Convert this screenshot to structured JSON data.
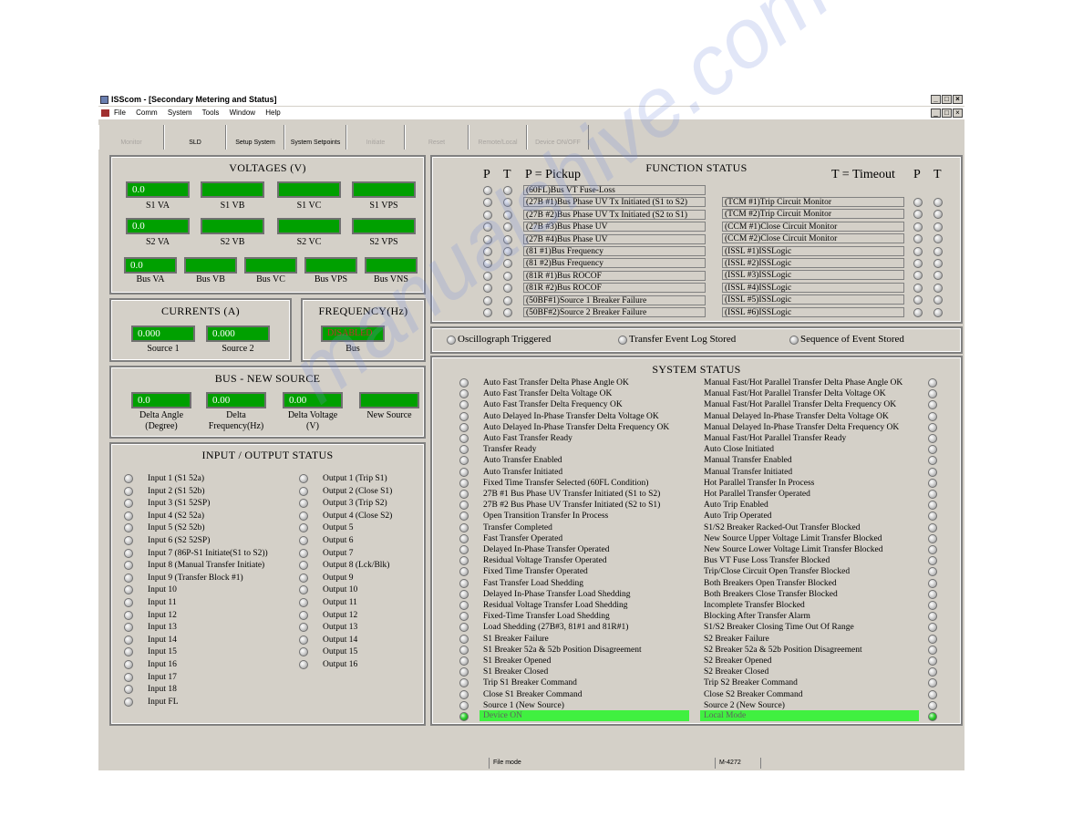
{
  "window": {
    "title": "ISScom - [Secondary Metering and Status]",
    "min": "_",
    "max": "□",
    "close": "×"
  },
  "menu": [
    "File",
    "Comm",
    "System",
    "Tools",
    "Window",
    "Help"
  ],
  "toolbar": [
    "Monitor",
    "SLD",
    "Setup System",
    "System Setpoints",
    "Initiate",
    "Reset",
    "Remote/Local",
    "Device ON/OFF"
  ],
  "voltages": {
    "title": "VOLTAGES (V)",
    "row1": [
      {
        "label": "S1 VA",
        "value": "0.0"
      },
      {
        "label": "S1 VB",
        "value": ""
      },
      {
        "label": "S1 VC",
        "value": ""
      },
      {
        "label": "S1 VPS",
        "value": ""
      }
    ],
    "row2": [
      {
        "label": "S2 VA",
        "value": "0.0"
      },
      {
        "label": "S2 VB",
        "value": ""
      },
      {
        "label": "S2 VC",
        "value": ""
      },
      {
        "label": "S2 VPS",
        "value": ""
      }
    ],
    "row3": [
      {
        "label": "Bus VA",
        "value": "0.0"
      },
      {
        "label": "Bus VB",
        "value": ""
      },
      {
        "label": "Bus VC",
        "value": ""
      },
      {
        "label": "Bus VPS",
        "value": ""
      },
      {
        "label": "Bus VNS",
        "value": ""
      }
    ]
  },
  "currents": {
    "title": "CURRENTS (A)",
    "items": [
      {
        "label": "Source 1",
        "value": "0.000"
      },
      {
        "label": "Source 2",
        "value": "0.000"
      }
    ]
  },
  "frequency": {
    "title": "FREQUENCY(Hz)",
    "value": "DISABLED",
    "label": "Bus"
  },
  "bus_new_source": {
    "title": "BUS - NEW SOURCE",
    "items": [
      {
        "value": "0.0",
        "label1": "Delta  Angle",
        "label2": "(Degree)"
      },
      {
        "value": "0.00",
        "label1": "Delta",
        "label2": "Frequency(Hz)"
      },
      {
        "value": "0.00",
        "label1": "Delta Voltage",
        "label2": "(V)"
      },
      {
        "value": "",
        "label1": "New Source",
        "label2": ""
      }
    ]
  },
  "io_status": {
    "title": "INPUT / OUTPUT STATUS",
    "inputs": [
      "Input 1 (S1 52a)",
      "Input 2 (S1 52b)",
      "Input 3 (S1 52SP)",
      "Input 4 (S2 52a)",
      "Input 5 (S2 52b)",
      "Input 6 (S2 52SP)",
      "Input 7 (86P-S1 Initiate(S1 to S2))",
      "Input 8 (Manual Transfer Initiate)",
      "Input 9 (Transfer Block #1)",
      "Input 10",
      "Input 11",
      "Input 12",
      "Input 13",
      "Input 14",
      "Input 15",
      "Input 16",
      "Input 17",
      "Input 18",
      "Input FL"
    ],
    "outputs": [
      "Output 1 (Trip S1)",
      "Output 2 (Close S1)",
      "Output 3 (Trip S2)",
      "Output 4 (Close S2)",
      "Output 5",
      "Output 6",
      "Output 7",
      "Output 8 (Lck/Blk)",
      "Output 9",
      "Output 10",
      "Output 11",
      "Output 12",
      "Output 13",
      "Output 14",
      "Output 15",
      "Output 16"
    ]
  },
  "function_status": {
    "title": "FUNCTION  STATUS",
    "p": "P",
    "t": "T",
    "pickup": "P = Pickup",
    "timeout": "T = Timeout",
    "left": [
      "(60FL)Bus VT Fuse-Loss",
      "(27B #1)Bus Phase UV Tx Initiated (S1 to S2)",
      "(27B #2)Bus Phase UV Tx Initiated (S2 to S1)",
      "(27B #3)Bus Phase UV",
      "(27B #4)Bus Phase UV",
      "(81 #1)Bus Frequency",
      "(81 #2)Bus Frequency",
      "(81R #1)Bus ROCOF",
      "(81R #2)Bus ROCOF",
      "(50BF#1)Source 1 Breaker Failure",
      "(50BF#2)Source 2 Breaker Failure"
    ],
    "right": [
      "(TCM #1)Trip Circuit Monitor",
      "(TCM #2)Trip Circuit Monitor",
      "(CCM #1)Close Circuit Monitor",
      "(CCM #2)Close Circuit Monitor",
      "(ISSL #1)ISSLogic",
      "(ISSL #2)ISSLogic",
      "(ISSL #3)ISSLogic",
      "(ISSL #4)ISSLogic",
      "(ISSL #5)ISSLogic",
      "(ISSL #6)ISSLogic"
    ]
  },
  "events": [
    "Oscillograph Triggered",
    "Transfer Event Log Stored",
    "Sequence of Event Stored"
  ],
  "system_status": {
    "title": "SYSTEM  STATUS",
    "left": [
      "Auto Fast Transfer Delta Phase Angle OK",
      "Auto Fast Transfer Delta Voltage OK",
      "Auto Fast Transfer Delta Frequency OK",
      "Auto Delayed In-Phase Transfer Delta Voltage OK",
      "Auto Delayed In-Phase Transfer Delta Frequency OK",
      "Auto Fast Transfer Ready",
      "Transfer Ready",
      "Auto Transfer Enabled",
      "Auto Transfer Initiated",
      "Fixed Time Transfer Selected (60FL Condition)",
      "27B #1 Bus Phase UV Transfer Initiated (S1 to S2)",
      "27B #2 Bus Phase UV Transfer Initiated (S2 to S1)",
      "Open Transition Transfer In Process",
      "Transfer Completed",
      "Fast Transfer Operated",
      "Delayed In-Phase Transfer Operated",
      "Residual Voltage Transfer Operated",
      "Fixed Time Transfer Operated",
      "Fast Transfer Load Shedding",
      "Delayed In-Phase Transfer Load Shedding",
      "Residual Voltage Transfer Load Shedding",
      "Fixed-Time Transfer Load Shedding",
      "Load Shedding (27B#3, 81#1 and 81R#1)",
      "S1 Breaker Failure",
      "S1 Breaker 52a & 52b Position Disagreement",
      "S1 Breaker Opened",
      "S1 Breaker Closed",
      "Trip S1 Breaker Command",
      "Close S1 Breaker Command",
      "Source 1 (New Source)"
    ],
    "right": [
      "Manual Fast/Hot Parallel Transfer Delta Phase Angle OK",
      "Manual Fast/Hot Parallel Transfer Delta Voltage OK",
      "Manual Fast/Hot Parallel Transfer Delta Frequency OK",
      "Manual Delayed In-Phase Transfer Delta Voltage OK",
      "Manual Delayed In-Phase Transfer Delta Frequency OK",
      "Manual Fast/Hot Parallel Transfer Ready",
      "Auto Close Initiated",
      "Manual Transfer Enabled",
      "Manual Transfer Initiated",
      "Hot Parallel Transfer In Process",
      "Hot Parallel Transfer Operated",
      "Auto Trip Enabled",
      "Auto Trip Operated",
      "S1/S2 Breaker Racked-Out Transfer Blocked",
      "New Source Upper Voltage Limit Transfer Blocked",
      "New Source Lower Voltage Limit Transfer Blocked",
      "Bus VT Fuse Loss Transfer Blocked",
      "Trip/Close Circuit Open Transfer Blocked",
      "Both Breakers Open Transfer Blocked",
      "Both Breakers Close Transfer Blocked",
      "Incomplete Transfer Blocked",
      "Blocking After Transfer Alarm",
      "S1/S2 Breaker Closing Time Out Of Range",
      "S2 Breaker Failure",
      "S2 Breaker 52a & 52b Position Disagreement",
      "S2 Breaker Opened",
      "S2 Breaker Closed",
      "Trip S2 Breaker Command",
      "Close S2 Breaker Command",
      "Source 2 (New Source)"
    ],
    "left_last": "Device ON",
    "right_last": "Local Mode"
  },
  "statusbar": {
    "mode": "File mode",
    "model": "M-4272"
  },
  "watermark": "manualshive.com",
  "colors": {
    "meter": "#00a000",
    "led_on": "#30d030",
    "status_green": "#40f040",
    "window_bg": "#d4d0c8"
  }
}
